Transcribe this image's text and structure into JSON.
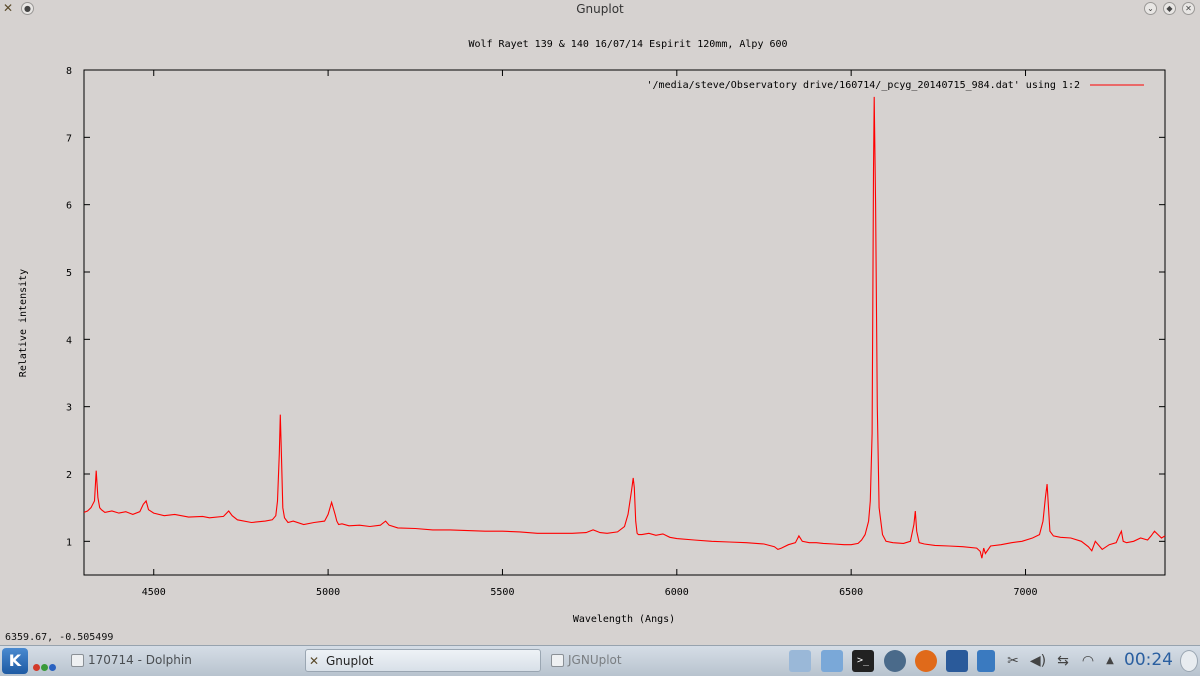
{
  "window": {
    "title": "Gnuplot"
  },
  "status_line": "6359.67, -0.505499",
  "chart_data": {
    "type": "line",
    "title": "Wolf Rayet 139 & 140 16/07/14 Espirit 120mm, Alpy 600",
    "xlabel": "Wavelength (Angs)",
    "ylabel": "Relative intensity",
    "xlim": [
      4300,
      7400
    ],
    "ylim": [
      0.5,
      8
    ],
    "xticks": [
      4500,
      5000,
      5500,
      6000,
      6500,
      7000
    ],
    "yticks": [
      1,
      2,
      3,
      4,
      5,
      6,
      7,
      8
    ],
    "grid": false,
    "legend_position": "top-right",
    "series_color": "#ff0000",
    "series": [
      {
        "name": "'/media/steve/Observatory drive/160714/_pcyg_20140715_984.dat' using 1:2",
        "x": [
          4300,
          4310,
          4320,
          4330,
          4335,
          4340,
          4345,
          4350,
          4360,
          4380,
          4400,
          4420,
          4440,
          4460,
          4470,
          4478,
          4485,
          4500,
          4530,
          4560,
          4600,
          4640,
          4660,
          4700,
          4715,
          4725,
          4740,
          4780,
          4820,
          4840,
          4850,
          4855,
          4860,
          4863,
          4866,
          4870,
          4875,
          4885,
          4900,
          4930,
          4960,
          4990,
          5000,
          5010,
          5020,
          5025,
          5030,
          5040,
          5060,
          5090,
          5120,
          5150,
          5165,
          5175,
          5200,
          5250,
          5300,
          5350,
          5400,
          5450,
          5500,
          5550,
          5600,
          5650,
          5700,
          5740,
          5760,
          5780,
          5800,
          5830,
          5850,
          5860,
          5870,
          5875,
          5878,
          5882,
          5886,
          5890,
          5900,
          5920,
          5940,
          5960,
          5980,
          6000,
          6050,
          6100,
          6150,
          6200,
          6250,
          6280,
          6290,
          6300,
          6320,
          6340,
          6350,
          6360,
          6380,
          6400,
          6420,
          6450,
          6480,
          6500,
          6520,
          6530,
          6540,
          6550,
          6555,
          6560,
          6562,
          6564,
          6566,
          6570,
          6575,
          6580,
          6590,
          6600,
          6620,
          6650,
          6670,
          6680,
          6684,
          6688,
          6695,
          6710,
          6740,
          6780,
          6820,
          6860,
          6870,
          6875,
          6880,
          6885,
          6900,
          6930,
          6960,
          6990,
          7020,
          7040,
          7050,
          7057,
          7062,
          7066,
          7070,
          7080,
          7100,
          7130,
          7160,
          7180,
          7190,
          7200,
          7220,
          7240,
          7260,
          7270,
          7275,
          7280,
          7290,
          7310,
          7330,
          7350,
          7360,
          7370,
          7380,
          7390,
          7400
        ],
        "y": [
          1.43,
          1.45,
          1.5,
          1.6,
          2.05,
          1.65,
          1.5,
          1.47,
          1.43,
          1.45,
          1.42,
          1.44,
          1.4,
          1.44,
          1.55,
          1.6,
          1.47,
          1.42,
          1.38,
          1.4,
          1.36,
          1.37,
          1.35,
          1.37,
          1.45,
          1.38,
          1.32,
          1.28,
          1.3,
          1.32,
          1.38,
          1.6,
          2.3,
          2.88,
          2.3,
          1.5,
          1.35,
          1.28,
          1.3,
          1.25,
          1.28,
          1.3,
          1.4,
          1.58,
          1.4,
          1.3,
          1.25,
          1.26,
          1.23,
          1.24,
          1.22,
          1.24,
          1.3,
          1.24,
          1.2,
          1.19,
          1.17,
          1.17,
          1.16,
          1.15,
          1.15,
          1.14,
          1.12,
          1.12,
          1.12,
          1.13,
          1.17,
          1.13,
          1.12,
          1.14,
          1.22,
          1.4,
          1.75,
          1.94,
          1.8,
          1.3,
          1.12,
          1.1,
          1.1,
          1.12,
          1.09,
          1.11,
          1.06,
          1.04,
          1.02,
          1.0,
          0.99,
          0.98,
          0.96,
          0.92,
          0.88,
          0.9,
          0.95,
          0.98,
          1.08,
          1.0,
          0.98,
          0.98,
          0.97,
          0.96,
          0.95,
          0.95,
          0.97,
          1.02,
          1.1,
          1.3,
          1.6,
          2.6,
          4.5,
          6.5,
          7.6,
          6.0,
          3.0,
          1.5,
          1.1,
          1.0,
          0.98,
          0.97,
          1.0,
          1.25,
          1.45,
          1.15,
          0.98,
          0.96,
          0.94,
          0.93,
          0.92,
          0.9,
          0.85,
          0.75,
          0.9,
          0.82,
          0.93,
          0.95,
          0.98,
          1.0,
          1.05,
          1.1,
          1.3,
          1.65,
          1.85,
          1.5,
          1.15,
          1.08,
          1.06,
          1.05,
          1.0,
          0.92,
          0.86,
          1.0,
          0.88,
          0.95,
          0.98,
          1.1,
          1.15,
          1.0,
          0.98,
          1.0,
          1.05,
          1.02,
          1.08,
          1.15,
          1.1,
          1.05,
          1.08
        ]
      }
    ]
  },
  "taskbar": {
    "tasks": [
      {
        "label": "170714 - Dolphin"
      },
      {
        "label": "Gnuplot"
      },
      {
        "label": "JGNUplot"
      }
    ],
    "clock": "00:24"
  }
}
